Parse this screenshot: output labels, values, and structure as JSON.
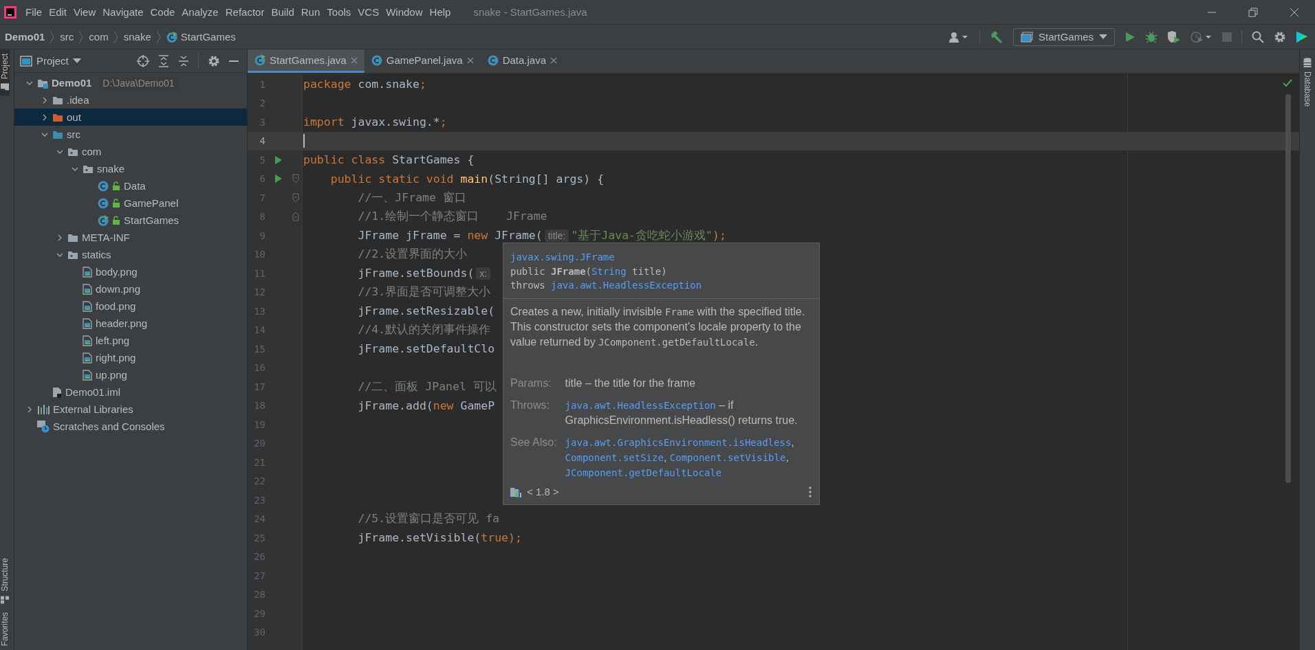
{
  "window": {
    "title": "snake - StartGames.java"
  },
  "menu": [
    "File",
    "Edit",
    "View",
    "Navigate",
    "Code",
    "Analyze",
    "Refactor",
    "Build",
    "Run",
    "Tools",
    "VCS",
    "Window",
    "Help"
  ],
  "breadcrumbs": [
    {
      "label": "Demo01",
      "kind": "project"
    },
    {
      "label": "src",
      "kind": "folder"
    },
    {
      "label": "com",
      "kind": "folder"
    },
    {
      "label": "snake",
      "kind": "folder"
    },
    {
      "label": "StartGames",
      "kind": "main-class"
    }
  ],
  "run_configuration": {
    "label": "StartGames"
  },
  "left_stripe": {
    "top": [
      {
        "label": "Project",
        "selected": true
      }
    ],
    "bottom": [
      {
        "label": "Structure",
        "selected": false
      },
      {
        "label": "Favorites",
        "selected": false
      }
    ]
  },
  "right_stripe": [
    {
      "label": "Database",
      "selected": false
    }
  ],
  "project_panel": {
    "title": "Project",
    "tree": [
      {
        "label": "Demo01",
        "kind": "module",
        "hint": "D:\\Java\\Demo01",
        "expanded": true,
        "selected": false,
        "children": [
          {
            "label": ".idea",
            "kind": "folder",
            "expanded": false,
            "selected": false
          },
          {
            "label": "out",
            "kind": "excluded",
            "expanded": false,
            "selected": true
          },
          {
            "label": "src",
            "kind": "source",
            "expanded": true,
            "selected": false,
            "children": [
              {
                "label": "com",
                "kind": "package",
                "expanded": true,
                "selected": false,
                "children": [
                  {
                    "label": "snake",
                    "kind": "package",
                    "expanded": true,
                    "selected": false,
                    "children": [
                      {
                        "label": "Data",
                        "kind": "class",
                        "selected": false
                      },
                      {
                        "label": "GamePanel",
                        "kind": "class",
                        "selected": false
                      },
                      {
                        "label": "StartGames",
                        "kind": "main-class",
                        "selected": false
                      }
                    ]
                  }
                ]
              },
              {
                "label": "META-INF",
                "kind": "folder",
                "expanded": false,
                "selected": false
              },
              {
                "label": "statics",
                "kind": "package",
                "expanded": true,
                "selected": false,
                "children": [
                  {
                    "label": "body.png",
                    "kind": "image",
                    "selected": false
                  },
                  {
                    "label": "down.png",
                    "kind": "image",
                    "selected": false
                  },
                  {
                    "label": "food.png",
                    "kind": "image",
                    "selected": false
                  },
                  {
                    "label": "header.png",
                    "kind": "image",
                    "selected": false
                  },
                  {
                    "label": "left.png",
                    "kind": "image",
                    "selected": false
                  },
                  {
                    "label": "right.png",
                    "kind": "image",
                    "selected": false
                  },
                  {
                    "label": "up.png",
                    "kind": "image",
                    "selected": false
                  }
                ]
              }
            ]
          },
          {
            "label": "Demo01.iml",
            "kind": "iml",
            "selected": false
          }
        ]
      },
      {
        "label": "External Libraries",
        "kind": "library",
        "expanded": false,
        "selected": false
      },
      {
        "label": "Scratches and Consoles",
        "kind": "scratches",
        "selected": false
      }
    ]
  },
  "tabs": [
    {
      "label": "StartGames.java",
      "kind": "main-class",
      "selected": true
    },
    {
      "label": "GamePanel.java",
      "kind": "class",
      "selected": false
    },
    {
      "label": "Data.java",
      "kind": "class",
      "selected": false
    }
  ],
  "editor": {
    "lines": [
      {
        "number": "1",
        "current": false,
        "run": false,
        "fold_start": false,
        "fold_end": false,
        "tokens": [
          {
            "text": "package",
            "kind": "keyword"
          },
          {
            "text": " com.snake",
            "kind": "plain"
          },
          {
            "text": ";",
            "kind": "punct"
          }
        ]
      },
      {
        "number": "2",
        "current": false,
        "run": false,
        "fold_start": false,
        "fold_end": false
      },
      {
        "number": "3",
        "current": false,
        "run": false,
        "fold_start": false,
        "fold_end": false,
        "tokens": [
          {
            "text": "import",
            "kind": "keyword"
          },
          {
            "text": " javax.swing.*",
            "kind": "plain"
          },
          {
            "text": ";",
            "kind": "punct"
          }
        ]
      },
      {
        "number": "4",
        "current": true,
        "run": false,
        "fold_start": false,
        "fold_end": false
      },
      {
        "number": "5",
        "current": false,
        "run": true,
        "fold_start": false,
        "fold_end": false,
        "tokens": [
          {
            "text": "public class",
            "kind": "keyword"
          },
          {
            "text": " StartGames {",
            "kind": "plain"
          }
        ]
      },
      {
        "number": "6",
        "current": false,
        "run": true,
        "fold_start": true,
        "fold_end": false,
        "tokens": [
          {
            "text": "    public static void ",
            "kind": "keyword"
          },
          {
            "text": "main",
            "kind": "method"
          },
          {
            "text": "(String[] args) {",
            "kind": "plain"
          }
        ]
      },
      {
        "number": "7",
        "current": false,
        "run": false,
        "fold_start": true,
        "fold_end": false,
        "tokens": [
          {
            "text": "        //一、JFrame 窗口",
            "kind": "comment"
          }
        ]
      },
      {
        "number": "8",
        "current": false,
        "run": false,
        "fold_start": false,
        "fold_end": true,
        "tokens": [
          {
            "text": "        //1.绘制一个静态窗口    JFrame",
            "kind": "comment"
          }
        ]
      },
      {
        "number": "9",
        "current": false,
        "run": false,
        "fold_start": false,
        "fold_end": false,
        "tokens": [
          {
            "text": "        JFrame jFrame = ",
            "kind": "plain"
          },
          {
            "text": "new",
            "kind": "keyword"
          },
          {
            "text": " JFrame(",
            "kind": "plain"
          },
          {
            "text": "title:",
            "kind": "hint"
          },
          {
            "text": "\"基于Java-贪吃蛇小游戏\"",
            "kind": "string"
          },
          {
            "text": ");",
            "kind": "punct"
          }
        ]
      },
      {
        "number": "10",
        "current": false,
        "run": false,
        "fold_start": false,
        "fold_end": false,
        "tokens": [
          {
            "text": "        //2.设置界面的大小",
            "kind": "comment"
          }
        ]
      },
      {
        "number": "11",
        "current": false,
        "run": false,
        "fold_start": false,
        "fold_end": false,
        "tokens": [
          {
            "text": "        jFrame.setBounds(",
            "kind": "plain"
          },
          {
            "text": "x:",
            "kind": "hint"
          }
        ]
      },
      {
        "number": "12",
        "current": false,
        "run": false,
        "fold_start": false,
        "fold_end": false,
        "tokens": [
          {
            "text": "        //3.界面是否可调整大小",
            "kind": "comment"
          }
        ]
      },
      {
        "number": "13",
        "current": false,
        "run": false,
        "fold_start": false,
        "fold_end": false,
        "tokens": [
          {
            "text": "        jFrame.setResizable(",
            "kind": "plain"
          }
        ]
      },
      {
        "number": "14",
        "current": false,
        "run": false,
        "fold_start": false,
        "fold_end": false,
        "tokens": [
          {
            "text": "        //4.默认的关闭事件操作",
            "kind": "comment"
          }
        ]
      },
      {
        "number": "15",
        "current": false,
        "run": false,
        "fold_start": false,
        "fold_end": false,
        "tokens": [
          {
            "text": "        jFrame.setDefaultClo",
            "kind": "plain"
          }
        ]
      },
      {
        "number": "16",
        "current": false,
        "run": false,
        "fold_start": false,
        "fold_end": false
      },
      {
        "number": "17",
        "current": false,
        "run": false,
        "fold_start": false,
        "fold_end": false,
        "tokens": [
          {
            "text": "        //二、面板 JPanel 可以",
            "kind": "comment"
          }
        ]
      },
      {
        "number": "18",
        "current": false,
        "run": false,
        "fold_start": false,
        "fold_end": false,
        "tokens": [
          {
            "text": "        jFrame.add(",
            "kind": "plain"
          },
          {
            "text": "new",
            "kind": "keyword"
          },
          {
            "text": " GameP",
            "kind": "plain"
          }
        ]
      },
      {
        "number": "19",
        "current": false,
        "run": false,
        "fold_start": false,
        "fold_end": false
      },
      {
        "number": "20",
        "current": false,
        "run": false,
        "fold_start": false,
        "fold_end": false
      },
      {
        "number": "21",
        "current": false,
        "run": false,
        "fold_start": false,
        "fold_end": false
      },
      {
        "number": "22",
        "current": false,
        "run": false,
        "fold_start": false,
        "fold_end": false
      },
      {
        "number": "23",
        "current": false,
        "run": false,
        "fold_start": false,
        "fold_end": false
      },
      {
        "number": "24",
        "current": false,
        "run": false,
        "fold_start": false,
        "fold_end": false,
        "tokens": [
          {
            "text": "        //5.设置窗口是否可见 fa",
            "kind": "comment"
          }
        ]
      },
      {
        "number": "25",
        "current": false,
        "run": false,
        "fold_start": false,
        "fold_end": false,
        "tokens": [
          {
            "text": "        jFrame.setVisible(",
            "kind": "plain"
          },
          {
            "text": "true",
            "kind": "keyword"
          },
          {
            "text": ");",
            "kind": "punct"
          }
        ]
      },
      {
        "number": "26",
        "current": false,
        "run": false,
        "fold_start": false,
        "fold_end": false
      },
      {
        "number": "27",
        "current": false,
        "run": false,
        "fold_start": false,
        "fold_end": false
      },
      {
        "number": "28",
        "current": false,
        "run": false,
        "fold_start": false,
        "fold_end": false
      },
      {
        "number": "29",
        "current": false,
        "run": false,
        "fold_start": false,
        "fold_end": false
      },
      {
        "number": "30",
        "current": false,
        "run": false,
        "fold_start": false,
        "fold_end": false
      }
    ]
  },
  "doc_popup": {
    "signature": [
      [
        {
          "text": "javax.swing.JFrame",
          "kind": "link"
        }
      ],
      [
        {
          "text": "public ",
          "kind": "mono"
        },
        {
          "text": "JFrame",
          "kind": "bold"
        },
        {
          "text": "(",
          "kind": "mono"
        },
        {
          "text": "String",
          "kind": "link"
        },
        {
          "text": " title)",
          "kind": "mono"
        }
      ],
      [
        {
          "text": "throws ",
          "kind": "mono"
        },
        {
          "text": "java.awt.HeadlessException",
          "kind": "link"
        }
      ]
    ],
    "description": [
      [
        {
          "text": "Creates a new, initially invisible ",
          "kind": "text"
        },
        {
          "text": "Frame",
          "kind": "mono"
        },
        {
          "text": " with the specified title.",
          "kind": "text"
        }
      ],
      [
        {
          "text": "This constructor sets the component's locale property to the value returned by ",
          "kind": "text"
        },
        {
          "text": "JComponent.getDefaultLocale",
          "kind": "mono"
        },
        {
          "text": ".",
          "kind": "text"
        }
      ]
    ],
    "sections": [
      {
        "label": "Params:",
        "content": [
          {
            "text": "title – the title for the frame",
            "kind": "text"
          }
        ]
      },
      {
        "label": "Throws:",
        "content": [
          {
            "text": "java.awt.HeadlessException",
            "kind": "link"
          },
          {
            "text": " – if GraphicsEnvironment.isHeadless() returns true.",
            "kind": "text"
          }
        ]
      },
      {
        "label": "See Also:",
        "content": [
          {
            "text": "java.awt.GraphicsEnvironment.isHeadless",
            "kind": "link"
          },
          {
            "text": ", ",
            "kind": "text"
          },
          {
            "text": "Component.setSize",
            "kind": "link"
          },
          {
            "text": ", ",
            "kind": "text"
          },
          {
            "text": "Component.setVisible",
            "kind": "link"
          },
          {
            "text": ", ",
            "kind": "text"
          },
          {
            "text": "JComponent.getDefaultLocale",
            "kind": "link"
          }
        ]
      }
    ],
    "footer": {
      "version": "< 1.8 >"
    }
  }
}
